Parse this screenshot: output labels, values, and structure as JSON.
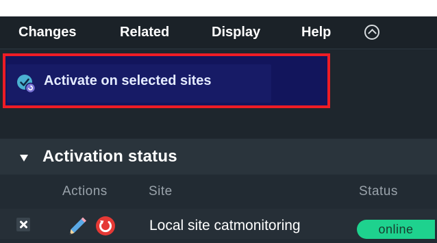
{
  "menubar": {
    "items": [
      "Changes",
      "Related",
      "Display",
      "Help"
    ],
    "collapse_icon": "chevron-up-circle-icon"
  },
  "action": {
    "activate_label": "Activate on selected sites",
    "activate_icon": "activate-changes-icon",
    "highlight_color": "#ee1c25"
  },
  "activation_status": {
    "title": "Activation status",
    "toggle_icon": "triangle-down-icon",
    "columns": {
      "actions": "Actions",
      "site": "Site",
      "status": "Status"
    },
    "rows": [
      {
        "site": "Local site catmonitoring",
        "status": "online",
        "status_color": "#1ed28e",
        "action_icons": [
          "discard-icon",
          "edit-icon",
          "restart-icon"
        ]
      }
    ]
  }
}
